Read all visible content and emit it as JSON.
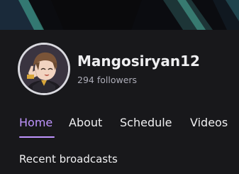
{
  "channel": {
    "name": "Mangosiryan12",
    "followers": "294 followers"
  },
  "tabs": [
    {
      "label": "Home",
      "active": true
    },
    {
      "label": "About",
      "active": false
    },
    {
      "label": "Schedule",
      "active": false
    },
    {
      "label": "Videos",
      "active": false
    }
  ],
  "section": {
    "title": "Recent broadcasts"
  },
  "colors": {
    "background": "#18181b",
    "accent": "#bf94ff",
    "text_primary": "#efeff1",
    "text_secondary": "#adadb8"
  },
  "icons": {
    "avatar": "anime-character-avatar"
  }
}
